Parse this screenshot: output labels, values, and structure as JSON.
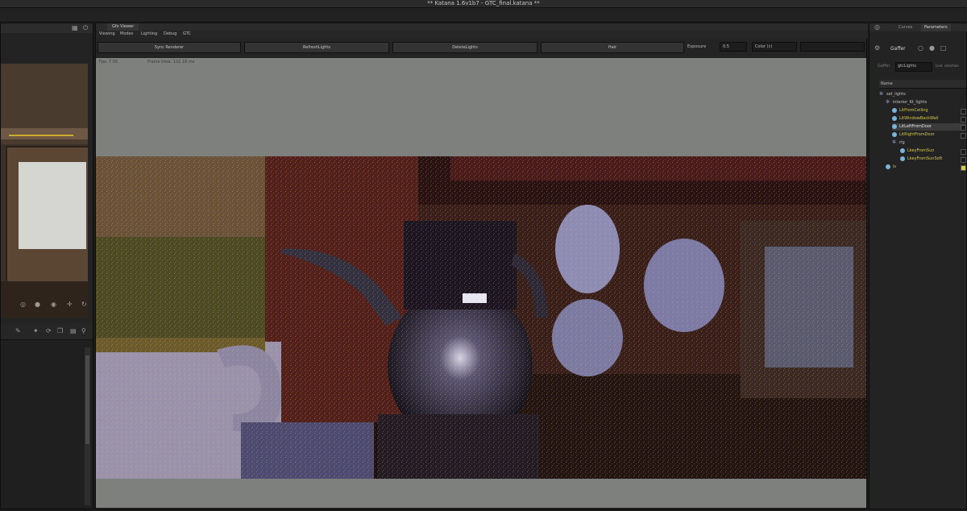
{
  "app": {
    "title": "** Katana 1.6v1b7 - GTC_final.katana **"
  },
  "viewer": {
    "tab_label": "Gfx Viewer",
    "menu": [
      "Viewing",
      "Modes",
      "Lighting",
      "Debug",
      "GTC"
    ],
    "buttons": {
      "sync_renderer": "Sync Renderer",
      "refresh_lights": "RefreshLights",
      "delete_lights": "DeleteLights",
      "hair": "Hair"
    },
    "exposure_label": "Exposure",
    "exposure_value": "0.5",
    "color_mode": "Color (c)",
    "fps_text": "Fps: 7.55",
    "frame_time_text": "Frame time: 132.18 ms"
  },
  "right_panel": {
    "tabs": [
      "Curves",
      "Parameters"
    ],
    "gaffer_label": "Gaffer",
    "param_label": "Gaffer",
    "param_value": "gtcLights",
    "param_extra": "Live: selection",
    "name_header": "Name",
    "tree": [
      {
        "label": "set_lights",
        "level": 0,
        "kind": "group"
      },
      {
        "label": "interior_Kt_lights",
        "level": 1,
        "kind": "group"
      },
      {
        "label": "LitFromCeiling",
        "level": 2,
        "kind": "light"
      },
      {
        "label": "LitWindowBackWall",
        "level": 2,
        "kind": "light"
      },
      {
        "label": "LitLeftFromDoor",
        "level": 2,
        "kind": "light"
      },
      {
        "label": "LitRightFromDoor",
        "level": 2,
        "kind": "light"
      },
      {
        "label": "rig",
        "level": 2,
        "kind": "group"
      },
      {
        "label": "LkeyFromSun",
        "level": 3,
        "kind": "light"
      },
      {
        "label": "LkeyFromSunSoft",
        "level": 3,
        "kind": "light"
      },
      {
        "label": "ls",
        "level": 1,
        "kind": "light"
      }
    ]
  },
  "colors": {
    "panel_bg": "#232323",
    "viewport_gray": "#7e807d",
    "light_label": "#d6c84a",
    "selected_row": "#3b3b3b"
  },
  "icons": {
    "left_top": [
      "window-icon",
      "power-icon"
    ],
    "left_tools": [
      "target-icon",
      "dot-icon",
      "record-icon",
      "move-icon",
      "rotate-icon"
    ],
    "left_toolbar2": [
      "pen-icon",
      "star-icon",
      "refresh-icon",
      "copy-icon",
      "stack-icon",
      "search-icon"
    ]
  }
}
